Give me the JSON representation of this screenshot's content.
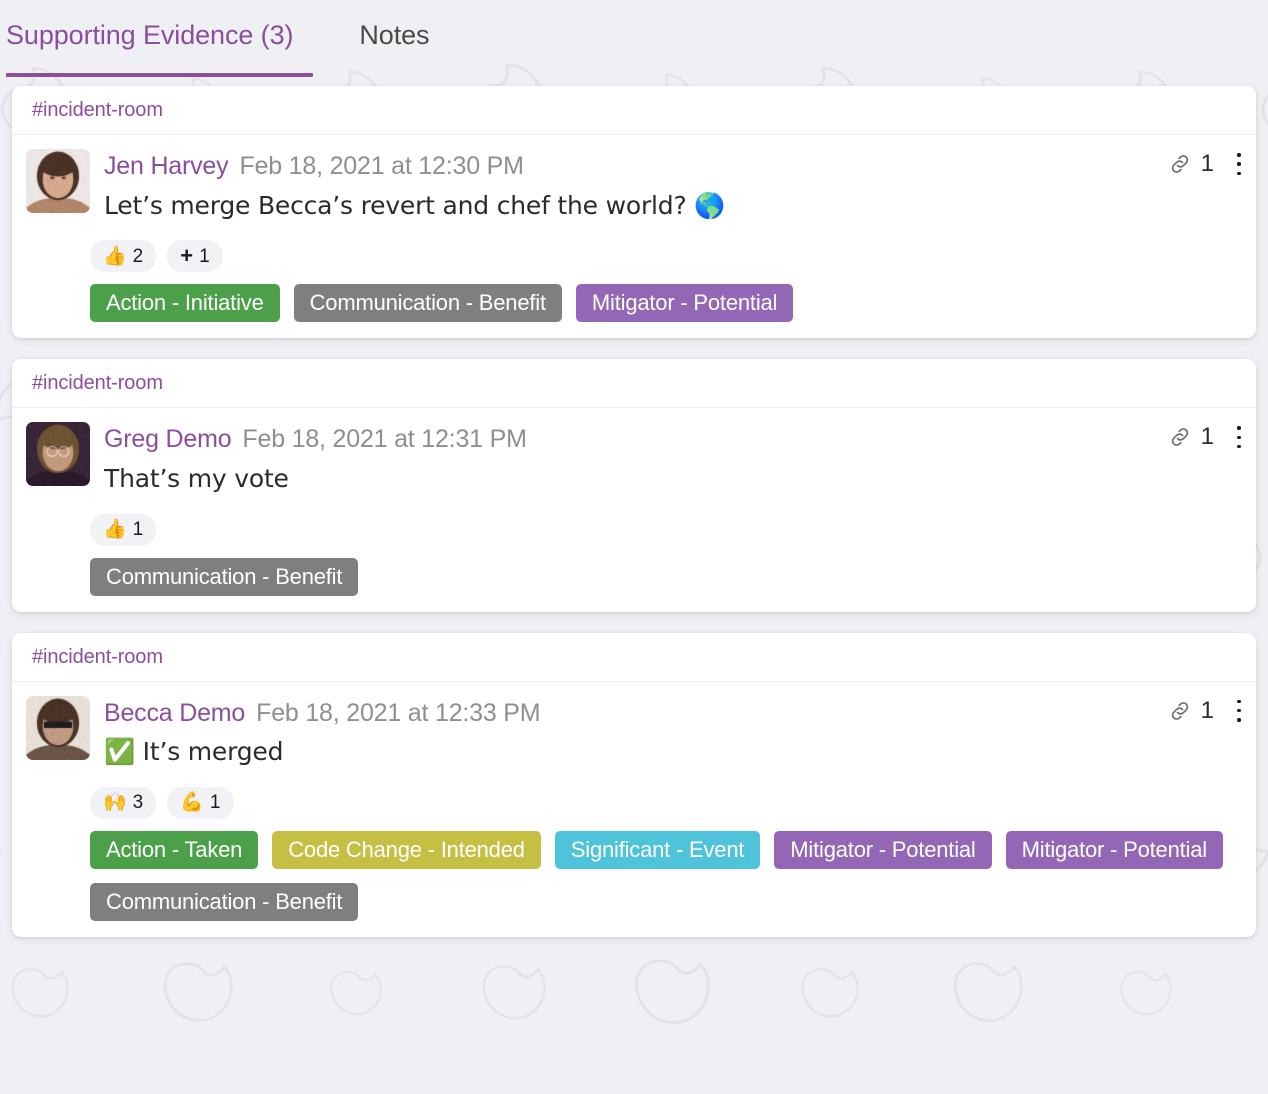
{
  "theme": {
    "accent": "#8c4d9e",
    "page_background": "#eff0f4",
    "card_background": "#ffffff",
    "timestamp_color": "#8e8e93",
    "reaction_pill_background": "#f1f2f5"
  },
  "tabs": [
    {
      "label": "Supporting Evidence (3)",
      "active": true
    },
    {
      "label": "Notes",
      "active": false
    }
  ],
  "cards": [
    {
      "channel": "#incident-room",
      "author": "Jen Harvey",
      "timestamp": "Feb 18, 2021 at 12:30 PM",
      "text": "Let’s merge Becca’s revert and chef the world? 🌎",
      "link_icon": "link-icon",
      "link_count": "1",
      "menu_icon": "kebab-menu-icon",
      "avatar_alt": "Jen Harvey avatar",
      "reactions": [
        {
          "emoji": "👍",
          "type": "emoji",
          "count": "2"
        },
        {
          "emoji": "+",
          "type": "plus",
          "count": "1"
        }
      ],
      "tags": [
        {
          "label": "Action - Initiative",
          "color": "#4ca049"
        },
        {
          "label": "Communication - Benefit",
          "color": "#7f7f7f"
        },
        {
          "label": "Mitigator - Potential",
          "color": "#9367b5"
        }
      ]
    },
    {
      "channel": "#incident-room",
      "author": "Greg Demo",
      "timestamp": "Feb 18, 2021 at 12:31 PM",
      "text": "That’s my vote",
      "link_icon": "link-icon",
      "link_count": "1",
      "menu_icon": "kebab-menu-icon",
      "avatar_alt": "Greg Demo avatar",
      "reactions": [
        {
          "emoji": "👍",
          "type": "emoji",
          "count": "1"
        }
      ],
      "tags": [
        {
          "label": "Communication - Benefit",
          "color": "#7f7f7f"
        }
      ]
    },
    {
      "channel": "#incident-room",
      "author": "Becca Demo",
      "timestamp": "Feb 18, 2021 at 12:33 PM",
      "text": "✅ It’s merged",
      "link_icon": "link-icon",
      "link_count": "1",
      "menu_icon": "kebab-menu-icon",
      "avatar_alt": "Becca Demo avatar",
      "reactions": [
        {
          "emoji": "🙌",
          "type": "emoji",
          "count": "3"
        },
        {
          "emoji": "💪",
          "type": "emoji",
          "count": "1"
        }
      ],
      "tags": [
        {
          "label": "Action - Taken",
          "color": "#4ca049"
        },
        {
          "label": "Code Change - Intended",
          "color": "#c5c044"
        },
        {
          "label": "Significant - Event",
          "color": "#4ec3d9"
        },
        {
          "label": "Mitigator - Potential",
          "color": "#9367b5"
        },
        {
          "label": "Mitigator - Potential",
          "color": "#9367b5"
        },
        {
          "label": "Communication - Benefit",
          "color": "#7f7f7f"
        }
      ]
    }
  ]
}
